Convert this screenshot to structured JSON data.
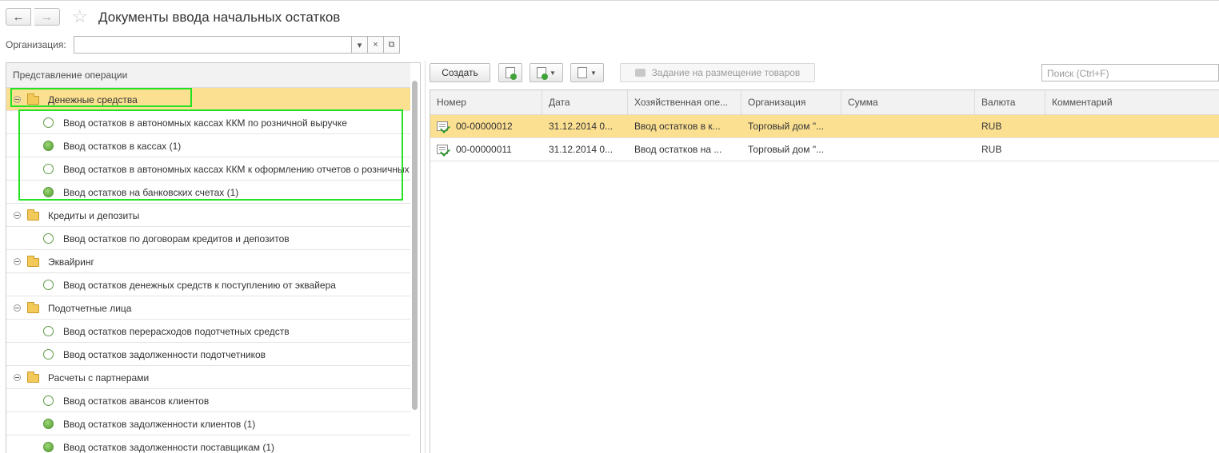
{
  "window": {
    "title": "Документы ввода начальных остатков"
  },
  "nav": {
    "back_glyph": "←",
    "forward_glyph": "→"
  },
  "filter": {
    "label": "Организация:",
    "value": "",
    "dropdown_glyph": "▾",
    "clear_glyph": "×",
    "open_glyph": "⧉"
  },
  "tree": {
    "header": "Представление операции",
    "rows": [
      {
        "kind": "group",
        "label": "Денежные средства",
        "selected": true
      },
      {
        "kind": "item",
        "label": "Ввод остатков в автономных кассах ККМ по розничной выручке",
        "filled": false
      },
      {
        "kind": "item",
        "label": "Ввод остатков в кассах (1)",
        "filled": true
      },
      {
        "kind": "item",
        "label": "Ввод остатков в автономных кассах ККМ к оформлению отчетов о розничных продажах",
        "filled": false
      },
      {
        "kind": "item",
        "label": "Ввод остатков на банковских счетах (1)",
        "filled": true
      },
      {
        "kind": "group",
        "label": "Кредиты и депозиты",
        "selected": false
      },
      {
        "kind": "item",
        "label": "Ввод остатков по договорам кредитов и депозитов",
        "filled": false
      },
      {
        "kind": "group",
        "label": "Эквайринг",
        "selected": false
      },
      {
        "kind": "item",
        "label": "Ввод остатков денежных средств к поступлению от эквайера",
        "filled": false
      },
      {
        "kind": "group",
        "label": "Подотчетные лица",
        "selected": false
      },
      {
        "kind": "item",
        "label": "Ввод остатков перерасходов подотчетных средств",
        "filled": false
      },
      {
        "kind": "item",
        "label": "Ввод остатков задолженности подотчетников",
        "filled": false
      },
      {
        "kind": "group",
        "label": "Расчеты с партнерами",
        "selected": false
      },
      {
        "kind": "item",
        "label": "Ввод остатков авансов клиентов",
        "filled": false
      },
      {
        "kind": "item",
        "label": "Ввод остатков задолженности клиентов (1)",
        "filled": true
      },
      {
        "kind": "item",
        "label": "Ввод остатков задолженности поставщикам (1)",
        "filled": true
      }
    ]
  },
  "toolbar": {
    "create_label": "Создать",
    "placement_label": "Задание на размещение товаров",
    "search_placeholder": "Поиск (Ctrl+F)"
  },
  "grid": {
    "columns": [
      "Номер",
      "Дата",
      "Хозяйственная опе...",
      "Организация",
      "Сумма",
      "Валюта",
      "Комментарий"
    ],
    "rows": [
      {
        "number": "00-00000012",
        "date": "31.12.2014 0...",
        "operation": "Ввод остатков в к...",
        "organization": "Торговый дом \"...",
        "sum": "",
        "currency": "RUB",
        "comment": "",
        "selected": true
      },
      {
        "number": "00-00000011",
        "date": "31.12.2014 0...",
        "operation": "Ввод остатков на ...",
        "organization": "Торговый дом \"...",
        "sum": "",
        "currency": "RUB",
        "comment": "",
        "selected": false
      }
    ]
  },
  "colors": {
    "selection": "#fbe092",
    "highlight": "#22e222",
    "status_green": "#4f9a2d"
  }
}
